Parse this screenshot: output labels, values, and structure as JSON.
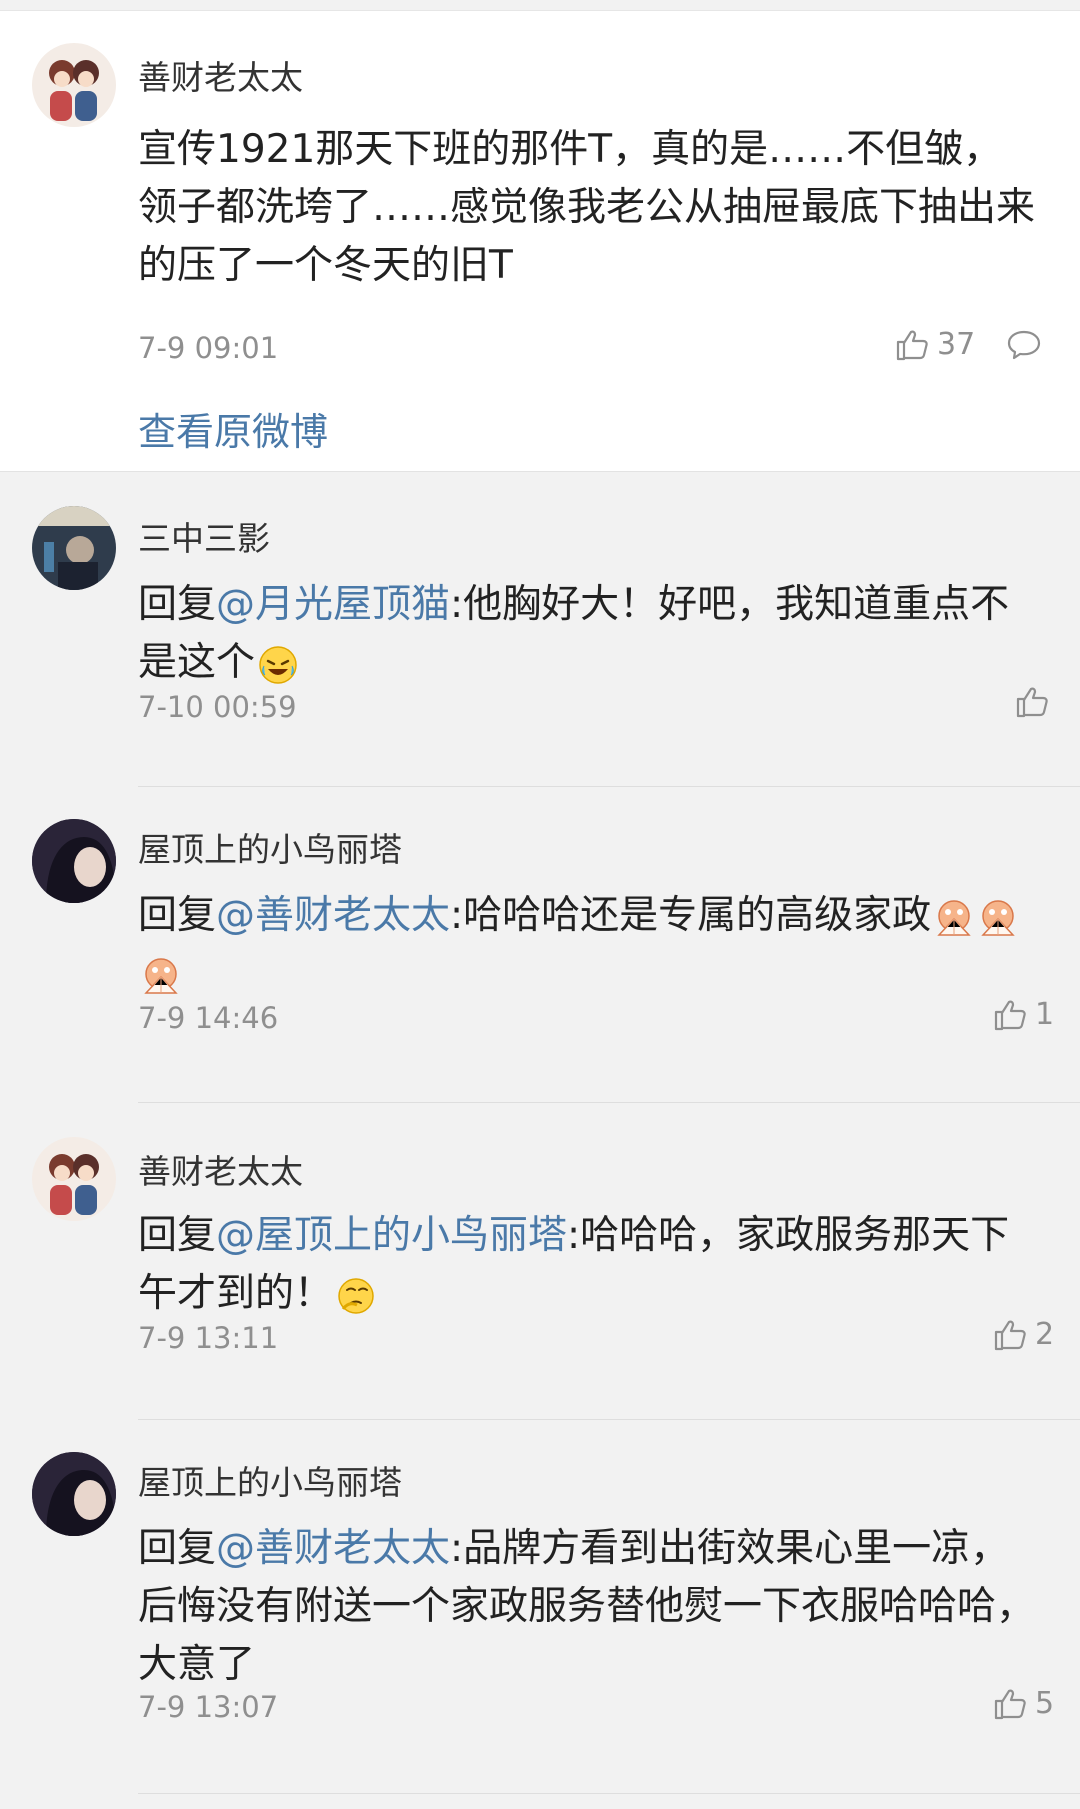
{
  "original": {
    "username": "善财老太太",
    "text": "宣传1921那天下班的那件T，真的是……不但皱，领子都洗垮了……感觉像我老公从抽屉最底下抽出来的压了一个冬天的旧T",
    "time": "7-9 09:01",
    "likes": "37",
    "view_original": "查看原微博"
  },
  "replies": [
    {
      "username": "三中三影",
      "reply_prefix": "回复",
      "mention": "@月光屋顶猫",
      "text": ":他胸好大！好吧，我知道重点不是这个",
      "time": "7-10 00:59",
      "likes": ""
    },
    {
      "username": "屋顶上的小鸟丽塔",
      "reply_prefix": "回复",
      "mention": "@善财老太太",
      "text": ":哈哈哈还是专属的高级家政",
      "time": "7-9 14:46",
      "likes": "1"
    },
    {
      "username": "善财老太太",
      "reply_prefix": "回复",
      "mention": "@屋顶上的小鸟丽塔",
      "text": ":哈哈哈，家政服务那天下午才到的！",
      "time": "7-9 13:11",
      "likes": "2"
    },
    {
      "username": "屋顶上的小鸟丽塔",
      "reply_prefix": "回复",
      "mention": "@善财老太太",
      "text": ":品牌方看到出街效果心里一凉，后悔没有附送一个家政服务替他熨一下衣服哈哈哈，大意了",
      "time": "7-9 13:07",
      "likes": "5"
    }
  ],
  "icons": {
    "like": "thumbs-up-icon",
    "comment": "comment-bubble-icon",
    "emoji_laugh": "laugh-cry-emoji",
    "emoji_fan": "fan-cover-face-emoji",
    "emoji_think": "thinking-emoji"
  },
  "colors": {
    "link": "#4a79a8",
    "meta": "#8f8f8f",
    "background": "#f2f2f2"
  }
}
